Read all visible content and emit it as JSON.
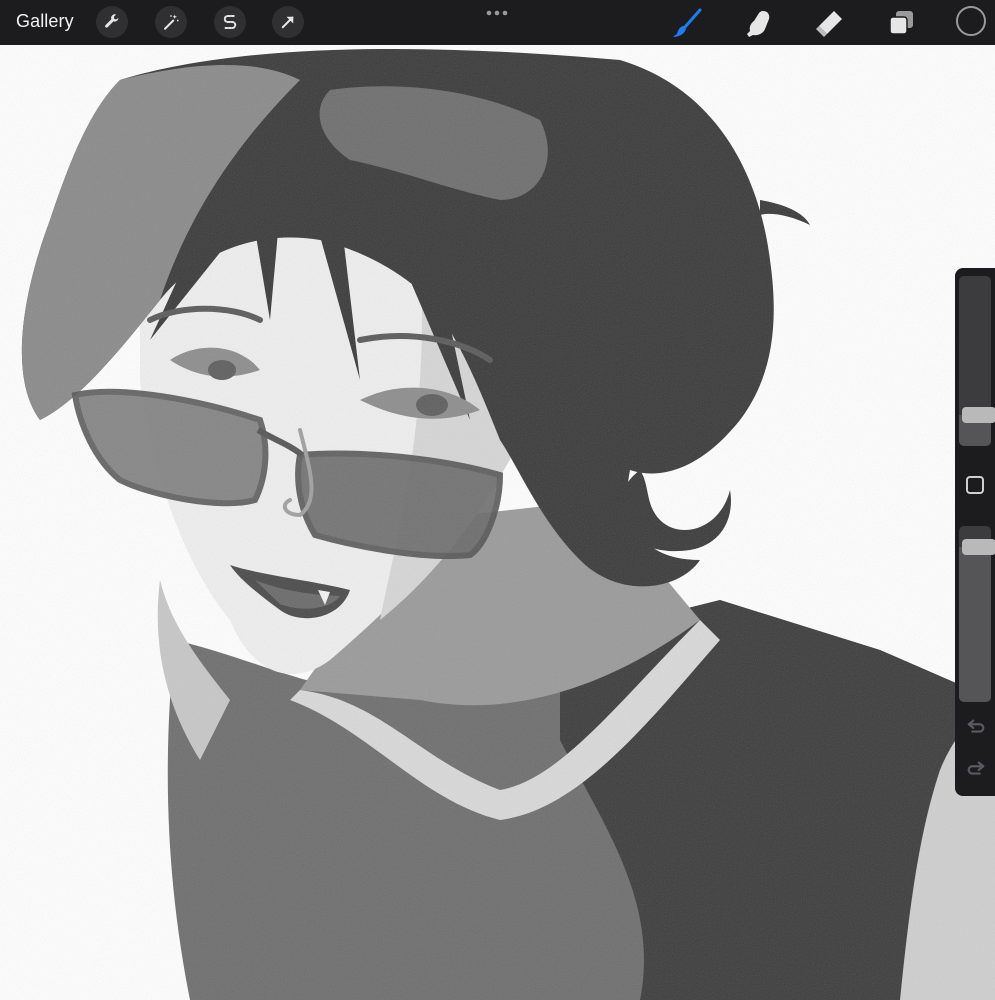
{
  "app": {
    "gallery_label": "Gallery",
    "accent_color": "#1e7cf2",
    "toolbar_bg": "#1c1c1e"
  },
  "toolbar": {
    "left_tools": [
      {
        "name": "actions",
        "icon": "wrench-icon"
      },
      {
        "name": "adjustments",
        "icon": "magic-wand-icon"
      },
      {
        "name": "selection",
        "icon": "selection-s-icon"
      },
      {
        "name": "transform",
        "icon": "arrow-cursor-icon"
      }
    ],
    "right_tools": [
      {
        "name": "paint",
        "icon": "brush-icon",
        "active": true
      },
      {
        "name": "smudge",
        "icon": "smudge-finger-icon"
      },
      {
        "name": "erase",
        "icon": "eraser-icon"
      },
      {
        "name": "layers",
        "icon": "layers-icon"
      },
      {
        "name": "color",
        "icon": "color-swatch",
        "value": "#1c1c1e"
      }
    ]
  },
  "sidebar": {
    "brush_size": 0.18,
    "opacity": 0.88,
    "undo_icon": "undo-arrow-icon",
    "redo_icon": "redo-arrow-icon"
  }
}
